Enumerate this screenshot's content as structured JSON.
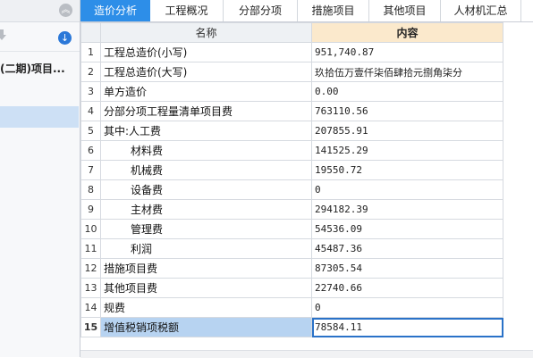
{
  "left_panel": {
    "project_name": "(二期)项目..."
  },
  "tabs": [
    {
      "label": "造价分析",
      "active": true
    },
    {
      "label": "工程概况",
      "active": false
    },
    {
      "label": "分部分项",
      "active": false
    },
    {
      "label": "措施项目",
      "active": false
    },
    {
      "label": "其他项目",
      "active": false
    },
    {
      "label": "人材机汇总",
      "active": false
    }
  ],
  "table": {
    "headers": {
      "name": "名称",
      "content": "内容"
    },
    "rows": [
      {
        "no": "1",
        "name": "工程总造价(小写)",
        "value": "951,740.87"
      },
      {
        "no": "2",
        "name": "工程总造价(大写)",
        "value": "玖拾伍万壹仟柒佰肆拾元捌角柒分"
      },
      {
        "no": "3",
        "name": "单方造价",
        "value": "0.00"
      },
      {
        "no": "4",
        "name": "分部分项工程量清单项目费",
        "value": "763110.56"
      },
      {
        "no": "5",
        "name": "其中:人工费",
        "value": "207855.91"
      },
      {
        "no": "6",
        "name": "材料费",
        "value": "141525.29"
      },
      {
        "no": "7",
        "name": "机械费",
        "value": "19550.72"
      },
      {
        "no": "8",
        "name": "设备费",
        "value": "0"
      },
      {
        "no": "9",
        "name": "主材费",
        "value": "294182.39"
      },
      {
        "no": "10",
        "name": "管理费",
        "value": "54536.09"
      },
      {
        "no": "11",
        "name": "利润",
        "value": "45487.36"
      },
      {
        "no": "12",
        "name": "措施项目费",
        "value": "87305.54"
      },
      {
        "no": "13",
        "name": "其他项目费",
        "value": "22740.66"
      },
      {
        "no": "14",
        "name": "规费",
        "value": "0"
      },
      {
        "no": "15",
        "name": "增值税销项税额",
        "value": "78584.11"
      }
    ]
  },
  "colors": {
    "tab_active": "#2d8ee8",
    "content_header": "#fbe9cc",
    "selected_row": "#b7d3f1",
    "selected_border": "#2a72c8"
  },
  "icons": [
    "chevron-up-icon",
    "download-icon",
    "down-arrow-icon"
  ]
}
